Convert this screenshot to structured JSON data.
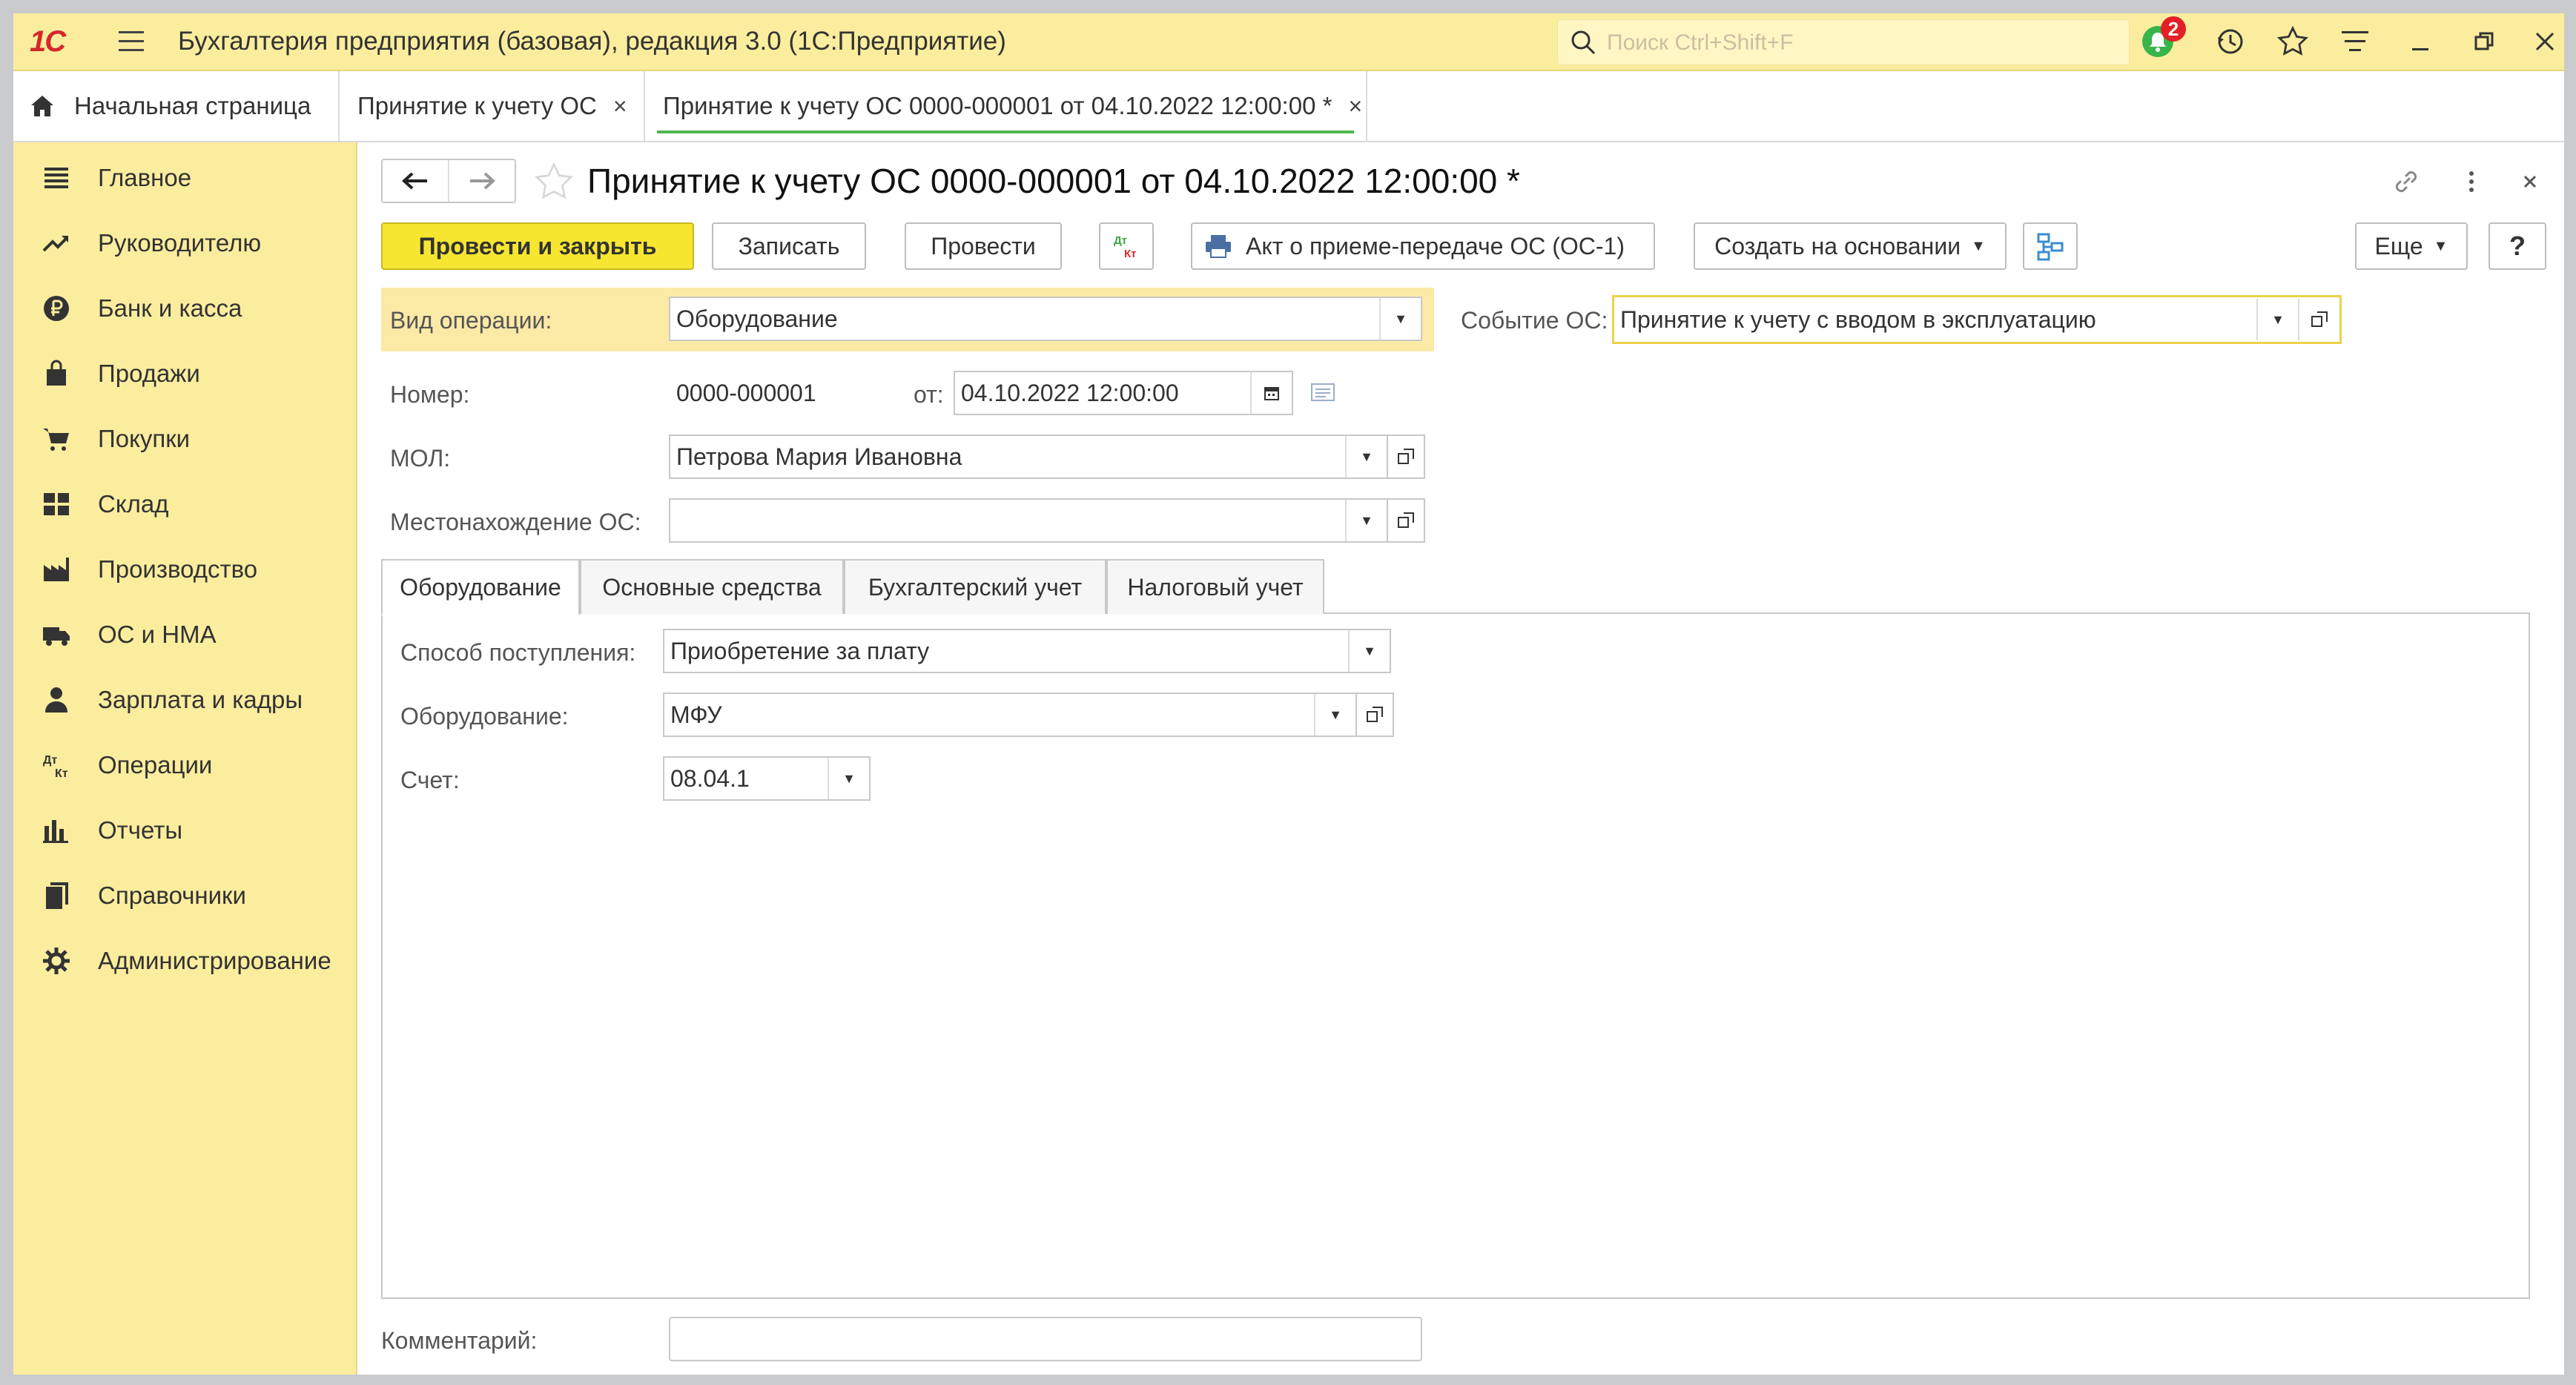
{
  "app": {
    "logo": "1С",
    "title": "Бухгалтерия предприятия (базовая), редакция 3.0  (1С:Предприятие)",
    "search_placeholder": "Поиск Ctrl+Shift+F",
    "notifications_count": "2"
  },
  "tabs": [
    {
      "label": "Начальная страница"
    },
    {
      "label": "Принятие к учету ОС",
      "close": "×"
    },
    {
      "label": "Принятие к учету ОС 0000-000001 от 04.10.2022 12:00:00 *",
      "close": "×"
    }
  ],
  "sidebar": {
    "items": [
      {
        "label": "Главное",
        "icon": "menu-lines-icon"
      },
      {
        "label": "Руководителю",
        "icon": "trend-icon"
      },
      {
        "label": "Банк и касса",
        "icon": "ruble-icon"
      },
      {
        "label": "Продажи",
        "icon": "bag-icon"
      },
      {
        "label": "Покупки",
        "icon": "cart-icon"
      },
      {
        "label": "Склад",
        "icon": "warehouse-icon"
      },
      {
        "label": "Производство",
        "icon": "factory-icon"
      },
      {
        "label": "ОС и НМА",
        "icon": "truck-icon"
      },
      {
        "label": "Зарплата и кадры",
        "icon": "person-icon"
      },
      {
        "label": "Операции",
        "icon": "dt-kt-icon"
      },
      {
        "label": "Отчеты",
        "icon": "bar-chart-icon"
      },
      {
        "label": "Справочники",
        "icon": "books-icon"
      },
      {
        "label": "Администрирование",
        "icon": "gear-icon"
      }
    ]
  },
  "document": {
    "title": "Принятие к учету ОС 0000-000001 от 04.10.2022 12:00:00 *",
    "toolbar": {
      "post_close": "Провести и закрыть",
      "save": "Записать",
      "post": "Провести",
      "dtkt_top": "Дт",
      "dtkt_bottom": "Кт",
      "act": "Акт о приеме-передаче ОС (ОС-1)",
      "create_based": "Создать на основании",
      "more": "Еще",
      "help": "?"
    },
    "fields": {
      "operation_label": "Вид операции:",
      "operation_value": "Оборудование",
      "event_label": "Событие ОС:",
      "event_value": "Принятие к учету с вводом в эксплуатацию",
      "number_label": "Номер:",
      "number_value": "0000-000001",
      "date_label": "от:",
      "date_value": "04.10.2022 12:00:00",
      "mol_label": "МОЛ:",
      "mol_value": "Петрова Мария Ивановна",
      "location_label": "Местонахождение ОС:",
      "location_value": ""
    },
    "form_tabs": [
      "Оборудование",
      "Основные средства",
      "Бухгалтерский учет",
      "Налоговый учет"
    ],
    "equipment_tab": {
      "receipt_label": "Способ поступления:",
      "receipt_value": "Приобретение за плату",
      "equipment_label": "Оборудование:",
      "equipment_value": "МФУ",
      "account_label": "Счет:",
      "account_value": "08.04.1"
    },
    "comment_label": "Комментарий:",
    "comment_value": ""
  },
  "colors": {
    "accent_yellow": "#fbed9e",
    "primary_button": "#f7e630",
    "active_tab_underline": "#4eb84e",
    "badge_red": "#e41f26"
  }
}
